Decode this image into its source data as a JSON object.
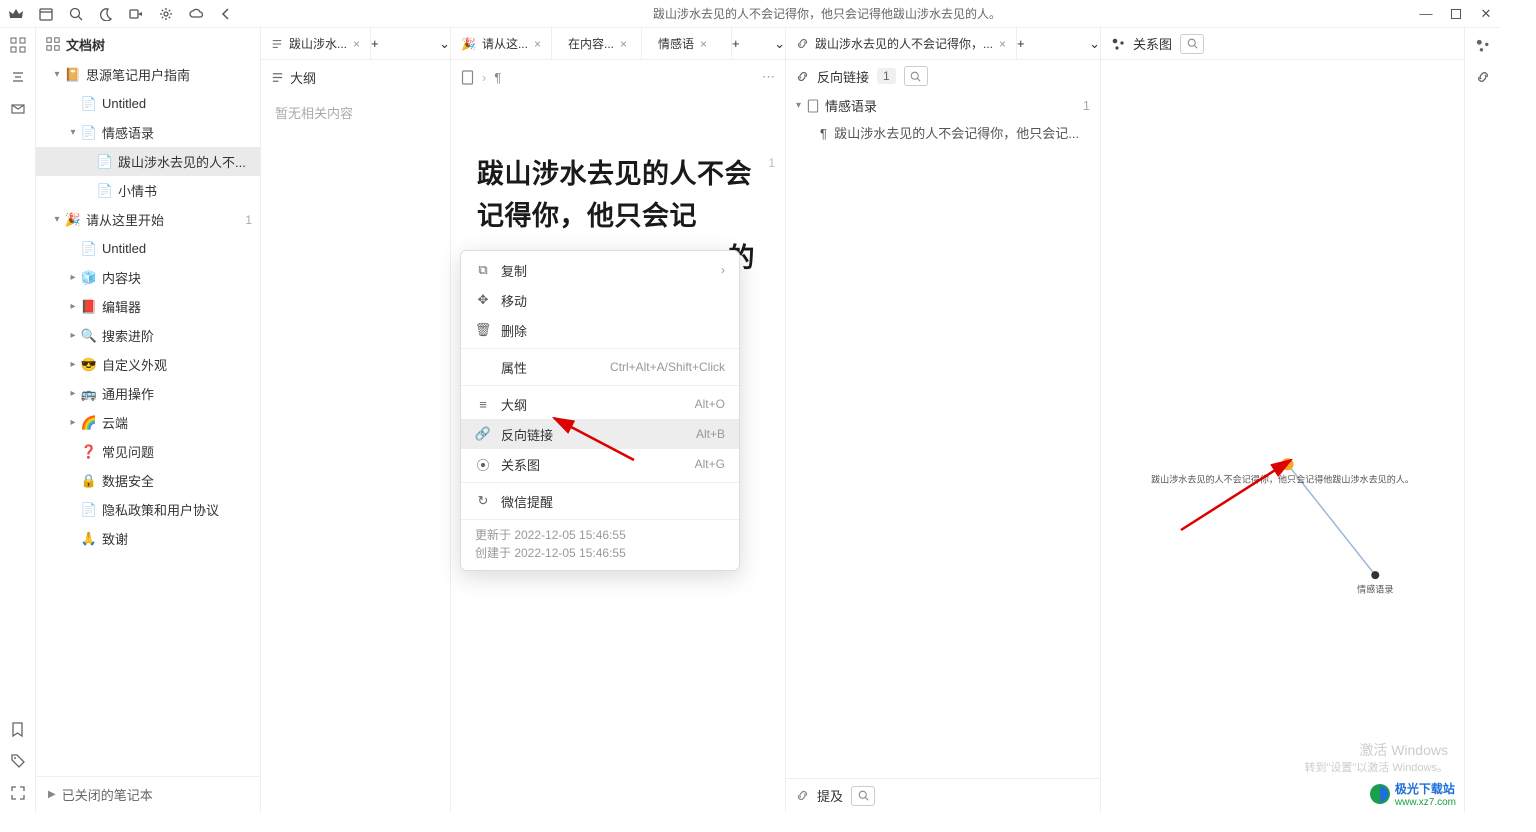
{
  "titlebar": {
    "title": "跋山涉水去见的人不会记得你，他只会记得他跋山涉水去见的人。"
  },
  "sidebar": {
    "header": "文档树",
    "closed_label": "已关闭的笔记本",
    "tree": [
      {
        "level": 1,
        "chev": "down",
        "icon": "📔",
        "label": "思源笔记用户指南",
        "count": ""
      },
      {
        "level": 2,
        "chev": "",
        "icon": "📄",
        "label": "Untitled",
        "count": ""
      },
      {
        "level": 2,
        "chev": "down",
        "icon": "📄",
        "label": "情感语录",
        "count": ""
      },
      {
        "level": 3,
        "chev": "",
        "icon": "📄",
        "label": "跋山涉水去见的人不...",
        "count": "",
        "selected": true
      },
      {
        "level": 3,
        "chev": "",
        "icon": "📄",
        "label": "小情书",
        "count": ""
      },
      {
        "level": 1,
        "chev": "down",
        "icon": "🎉",
        "label": "请从这里开始",
        "count": "1"
      },
      {
        "level": 2,
        "chev": "",
        "icon": "📄",
        "label": "Untitled",
        "count": ""
      },
      {
        "level": 2,
        "chev": "right",
        "icon": "🧊",
        "label": "内容块",
        "count": ""
      },
      {
        "level": 2,
        "chev": "right",
        "icon": "📕",
        "label": "编辑器",
        "count": ""
      },
      {
        "level": 2,
        "chev": "right",
        "icon": "🔍",
        "label": "搜索进阶",
        "count": ""
      },
      {
        "level": 2,
        "chev": "right",
        "icon": "😎",
        "label": "自定义外观",
        "count": ""
      },
      {
        "level": 2,
        "chev": "right",
        "icon": "🚌",
        "label": "通用操作",
        "count": ""
      },
      {
        "level": 2,
        "chev": "right",
        "icon": "🌈",
        "label": "云端",
        "count": ""
      },
      {
        "level": 2,
        "chev": "",
        "icon": "❓",
        "label": "常见问题",
        "count": ""
      },
      {
        "level": 2,
        "chev": "",
        "icon": "🔒",
        "label": "数据安全",
        "count": ""
      },
      {
        "level": 2,
        "chev": "",
        "icon": "📄",
        "label": "隐私政策和用户协议",
        "count": ""
      },
      {
        "level": 2,
        "chev": "",
        "icon": "🙏",
        "label": "致谢",
        "count": ""
      }
    ]
  },
  "outline": {
    "tab": "跋山涉水...",
    "head": "大纲",
    "empty": "暂无相关内容"
  },
  "editor": {
    "tabs": [
      "请从这...",
      "在内容...",
      "情感语"
    ],
    "title": "跋山涉水去见的人不会记得你，他只会记",
    "title_cont": "的",
    "badge": "1"
  },
  "context_menu": {
    "items": [
      {
        "icon": "copy",
        "label": "复制",
        "shortcut": "›"
      },
      {
        "icon": "move",
        "label": "移动",
        "shortcut": ""
      },
      {
        "icon": "trash",
        "label": "删除",
        "shortcut": ""
      },
      {
        "sep": true
      },
      {
        "icon": "",
        "label": "属性",
        "shortcut": "Ctrl+Alt+A/Shift+Click"
      },
      {
        "sep": true
      },
      {
        "icon": "outline",
        "label": "大纲",
        "shortcut": "Alt+O"
      },
      {
        "icon": "link",
        "label": "反向链接",
        "shortcut": "Alt+B",
        "hl": true
      },
      {
        "icon": "graph",
        "label": "关系图",
        "shortcut": "Alt+G"
      },
      {
        "sep": true
      },
      {
        "icon": "wechat",
        "label": "微信提醒",
        "shortcut": ""
      }
    ],
    "updated": "更新于 2022-12-05 15:46:55",
    "created": "创建于 2022-12-05 15:46:55"
  },
  "backlinks": {
    "tab": "跋山涉水去见的人不会记得你，...",
    "head": "反向链接",
    "count": "1",
    "entry_label": "情感语录",
    "entry_count": "1",
    "sub": "跋山涉水去见的人不会记得你，他只会记...",
    "foot": "提及"
  },
  "graph": {
    "head": "关系图",
    "node1": "跋山涉水去见的人不会记得你，他只会记得他跋山涉水去见的人。",
    "node2": "情感语录"
  },
  "watermark": {
    "l1": "激活 Windows",
    "l2": "转到\"设置\"以激活 Windows。"
  },
  "logo": {
    "brand": "极光下载站",
    "url": "www.xz7.com"
  }
}
